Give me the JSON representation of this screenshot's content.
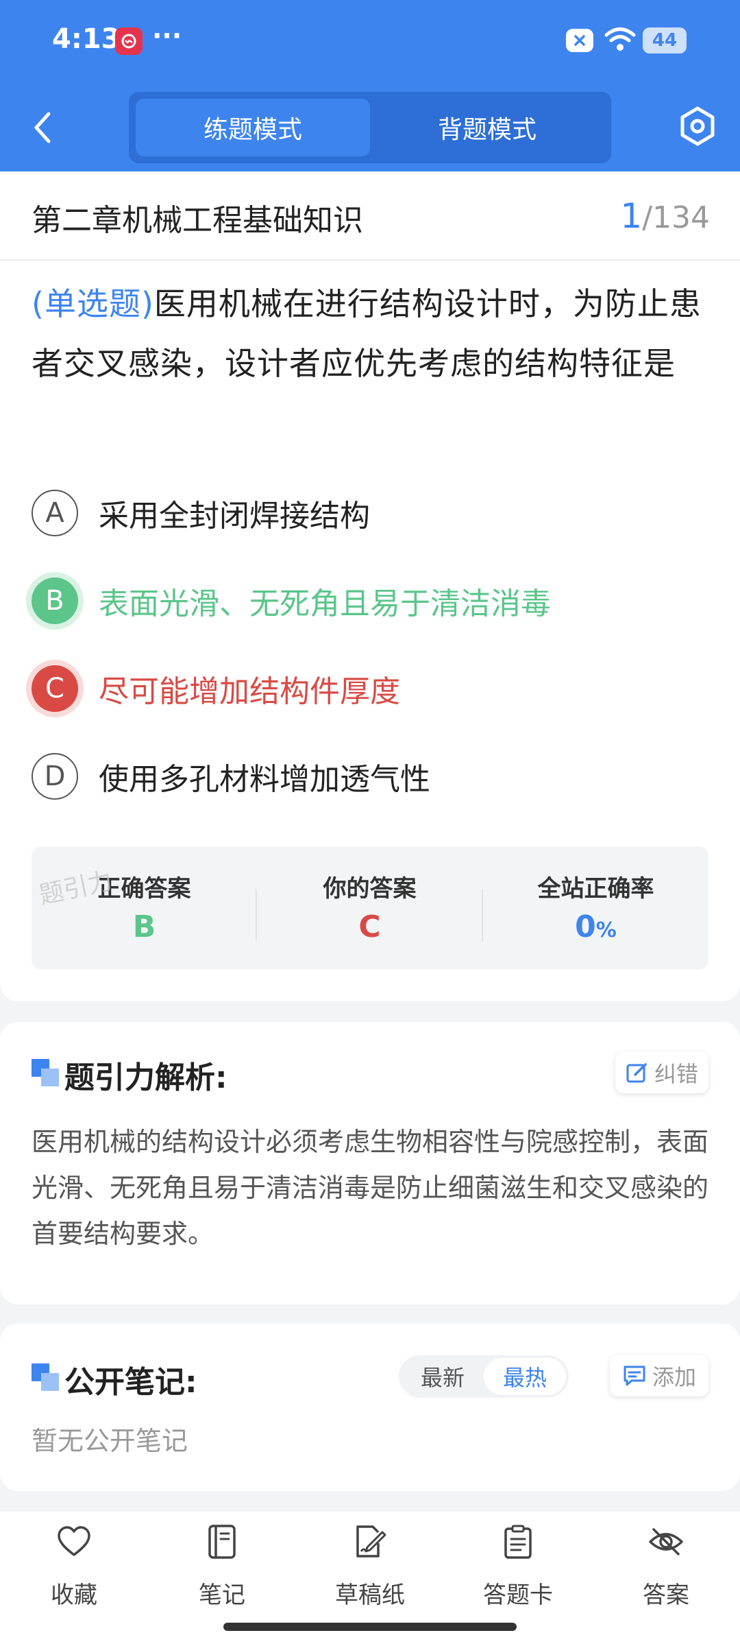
{
  "status_bar": {
    "time": "4:13",
    "dots": "···",
    "battery": "44"
  },
  "header": {
    "modes": [
      "练题模式",
      "背题模式"
    ],
    "active_mode": "练题模式"
  },
  "question_info": {
    "chapter": "第二章机械工程基础知识",
    "current": "1",
    "total": "/134"
  },
  "question": {
    "type": "(单选题)",
    "text": "医用机械在进行结构设计时，为防止患者交叉感染，设计者应优先考虑的结构特征是",
    "options": [
      {
        "letter": "A",
        "text": "采用全封闭焊接结构",
        "state": "normal"
      },
      {
        "letter": "B",
        "text": "表面光滑、无死角且易于清洁消毒",
        "state": "correct"
      },
      {
        "letter": "C",
        "text": "尽可能增加结构件厚度",
        "state": "wrong"
      },
      {
        "letter": "D",
        "text": "使用多孔材料增加透气性",
        "state": "normal"
      }
    ]
  },
  "answer_summary": {
    "correct_label": "正确答案",
    "correct_value": "B",
    "yours_label": "你的答案",
    "yours_value": "C",
    "rate_label": "全站正确率",
    "rate_value": "0",
    "rate_unit": "%",
    "watermark": "题引力"
  },
  "analysis": {
    "title": "题引力解析:",
    "report_label": "纠错",
    "text": "医用机械的结构设计必须考虑生物相容性与院感控制，表面光滑、无死角且易于清洁消毒是防止细菌滋生和交叉感染的首要结构要求。"
  },
  "notes": {
    "title": "公开笔记:",
    "sort_newest": "最新",
    "sort_hottest": "最热",
    "active_sort": "最热",
    "add_label": "添加",
    "empty_text": "暂无公开笔记"
  },
  "bottom_nav": [
    {
      "label": "收藏",
      "icon": "heart-icon"
    },
    {
      "label": "笔记",
      "icon": "notebook-icon"
    },
    {
      "label": "草稿纸",
      "icon": "draft-paper-icon"
    },
    {
      "label": "答题卡",
      "icon": "answer-card-icon"
    },
    {
      "label": "答案",
      "icon": "eye-off-icon"
    }
  ],
  "colors": {
    "primary": "#3d84ef",
    "correct": "#5bc58a",
    "wrong": "#d94a45"
  }
}
